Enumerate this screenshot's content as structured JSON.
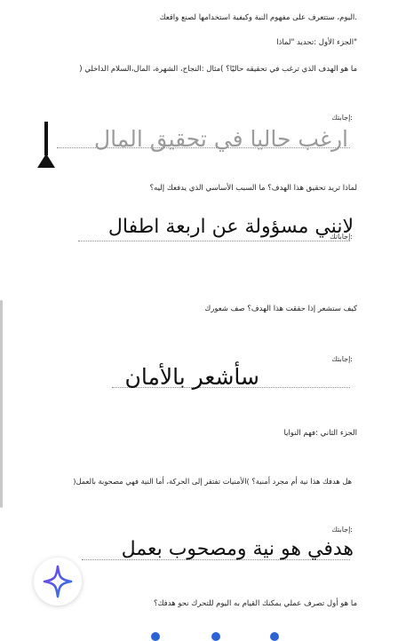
{
  "intro": {
    "line1": ".اليوم، ستتعرف على مفهوم النية وكيفية استخدامها لصنع واقعك",
    "line2": "\"الجزء الأول :تحديد \"لماذا",
    "line3": "ما هو الهدف الذي ترغب في تحقيقه حاليًا؟ )مثال :النجاح، الشهرة، المال،السلام الداخلي ("
  },
  "answer_label": ":إجابتك",
  "answer_label_alt": ":إجاباتك",
  "answers": {
    "a1": "ارغب حاليا في تحقيق المال",
    "a2": "لانني مسؤولة عن اربعة اطفال",
    "a3": "سأشعر بالأمان",
    "a4": "هدفي هو نية ومصحوب بعمل"
  },
  "questions": {
    "q2": "لماذا تريد تحقيق هذا الهدف؟ ما السبب الأساسي الذي يدفعك إليه؟",
    "q3": "كيف ستشعر إذا حققت هذا الهدف؟ صف شعورك",
    "part2": "الجزء الثاني :فهم النوايا",
    "q4": "هل هدفك هذا نية أم مجرد أمنية؟ )الأمنيات تفتقر إلى الحركة، أما النية فهي مصحوبة بالعمل(",
    "q5": "ما هو أول تصرف عملي يمكنك القيام به اليوم للتحرك نحو هدفك؟"
  },
  "colors": {
    "ink": "#111111",
    "ghost_ink": "#9b9b9b",
    "accent_gradient": [
      "#7b3cf0",
      "#2a7be4"
    ]
  },
  "icons": {
    "assistant": "sparkle-icon",
    "cursor": "text-cursor-icon"
  }
}
